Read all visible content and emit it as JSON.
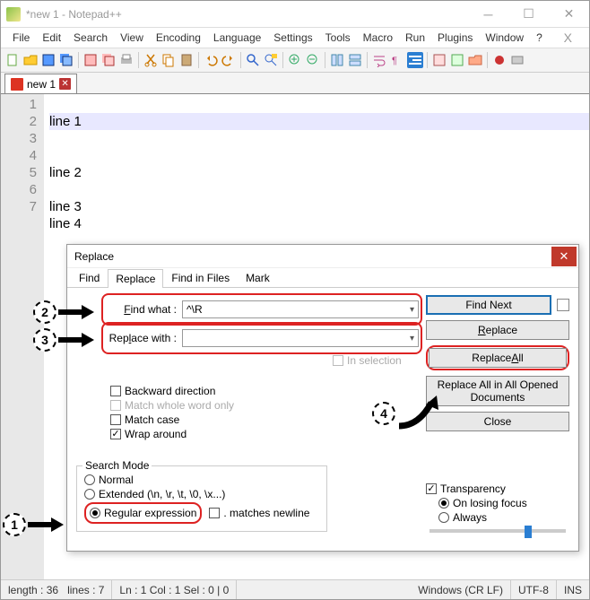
{
  "window": {
    "title": "*new 1 - Notepad++"
  },
  "menu": {
    "items": [
      "File",
      "Edit",
      "Search",
      "View",
      "Encoding",
      "Language",
      "Settings",
      "Tools",
      "Macro",
      "Run",
      "Plugins",
      "Window",
      "?"
    ]
  },
  "tab": {
    "name": "new 1"
  },
  "editor": {
    "gutter": [
      "1",
      "2",
      "3",
      "4",
      "5",
      "6",
      "7"
    ],
    "lines": [
      "line 1",
      "",
      "",
      "line 2",
      "",
      "line 3",
      "line 4"
    ]
  },
  "status": {
    "length": "length : 36",
    "lines": "lines : 7",
    "pos": "Ln : 1    Col : 1    Sel : 0 | 0",
    "eol": "Windows (CR LF)",
    "enc": "UTF-8",
    "mode": "INS"
  },
  "dialog": {
    "title": "Replace",
    "tabs": {
      "find": "Find",
      "replace": "Replace",
      "findfiles": "Find in Files",
      "mark": "Mark"
    },
    "find_label": "Find what :",
    "find_value": "^\\R",
    "replace_label": "Replace with :",
    "replace_value": "",
    "in_selection": "In selection",
    "backward": "Backward direction",
    "whole_word": "Match whole word only",
    "match_case": "Match case",
    "wrap": "Wrap around",
    "search_mode_label": "Search Mode",
    "mode_normal": "Normal",
    "mode_extended": "Extended (\\n, \\r, \\t, \\0, \\x...)",
    "mode_regex": "Regular expression",
    "matches_newline": ". matches newline",
    "btn_find_next": "Find Next",
    "btn_replace": "Replace",
    "btn_replace_all": "Replace All",
    "btn_replace_all_docs": "Replace All in All Opened Documents",
    "btn_close": "Close",
    "transparency": "Transparency",
    "on_losing_focus": "On losing focus",
    "always": "Always"
  },
  "annotations": {
    "n1": "1",
    "n2": "2",
    "n3": "3",
    "n4": "4"
  }
}
